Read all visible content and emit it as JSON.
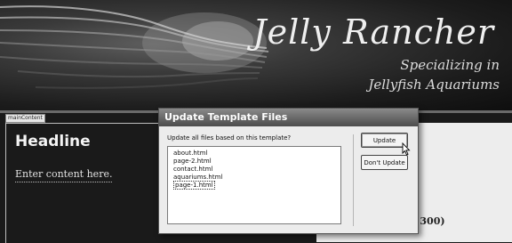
{
  "site": {
    "title": "Jelly Rancher",
    "tagline_1": "Specializing in",
    "tagline_2": "Jellyfish Aquariums"
  },
  "editable_region": {
    "tag": "mainContent",
    "headline": "Headline",
    "content": "Enter content here."
  },
  "side_panel": {
    "text": "x 300)"
  },
  "dialog": {
    "title": "Update Template Files",
    "prompt": "Update all files based on this template?",
    "files": [
      "about.html",
      "page-2.html",
      "contact.html",
      "aquariums.html",
      "page-1.html"
    ],
    "selected_file": "page-1.html",
    "update_label": "Update",
    "dont_update_label": "Don't Update"
  }
}
